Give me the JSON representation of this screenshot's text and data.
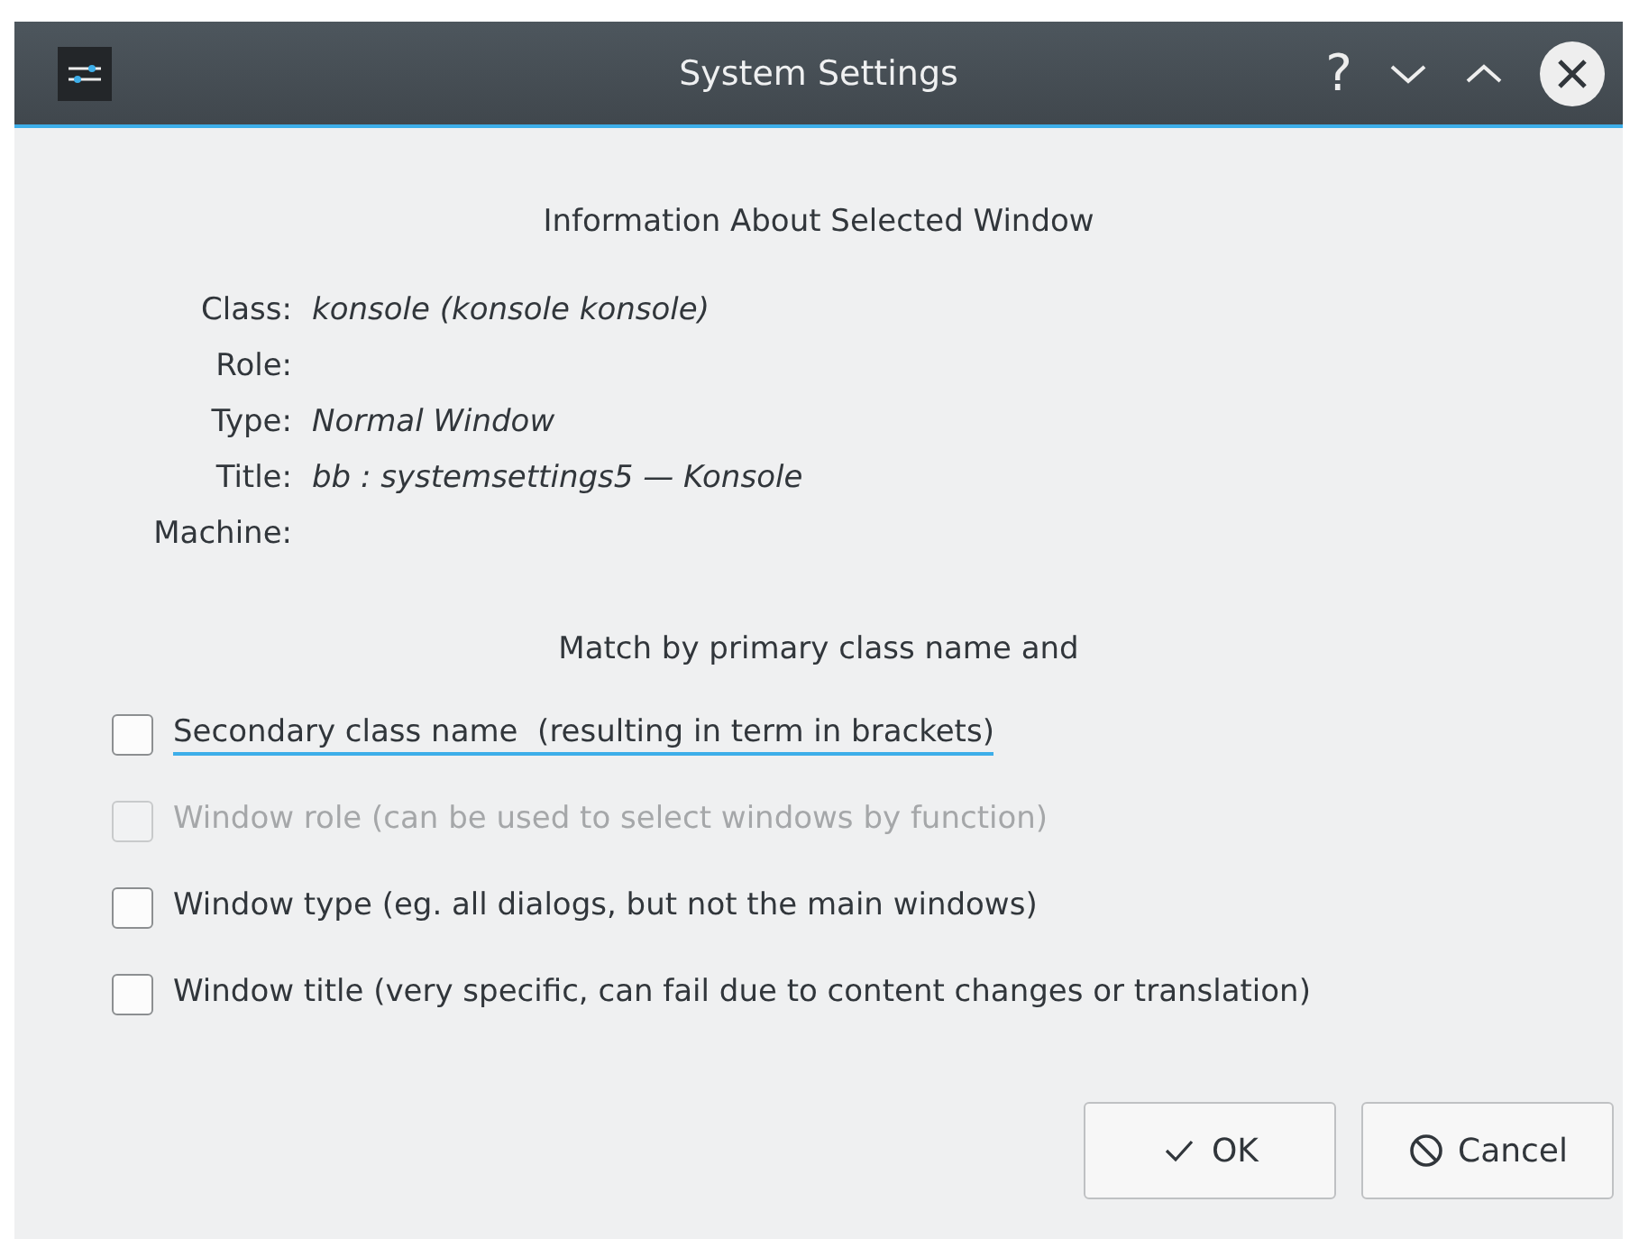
{
  "window": {
    "title": "System Settings",
    "controls": [
      "?"
    ]
  },
  "info": {
    "heading": "Information About Selected Window",
    "rows": [
      {
        "label": "Class:",
        "value": "konsole (konsole konsole)"
      },
      {
        "label": "Role:"
      },
      {
        "label": "Type:",
        "value": "Normal Window"
      },
      {
        "label": "Title:",
        "value": "bb : systemsettings5 — Konsole"
      },
      {
        "label": "Machine:"
      }
    ]
  },
  "match": {
    "heading": "Match by primary class name and",
    "options": [
      {
        "label": "Secondary class name  (resulting in term in brackets)",
        "checked": false,
        "disabled": false,
        "focused": true
      },
      {
        "label": "Window role (can be used to select windows by function)",
        "checked": false,
        "disabled": true,
        "focused": false
      },
      {
        "label": "Window type (eg. all dialogs, but not the main windows)",
        "checked": false,
        "disabled": false,
        "focused": false
      },
      {
        "label": "Window title (very specific, can fail due to content changes or translation)",
        "checked": false,
        "disabled": false,
        "focused": false
      }
    ]
  },
  "buttons": [
    {
      "kind": "ok",
      "label": "OK"
    },
    {
      "kind": "cancel",
      "label": "Cancel"
    }
  ]
}
